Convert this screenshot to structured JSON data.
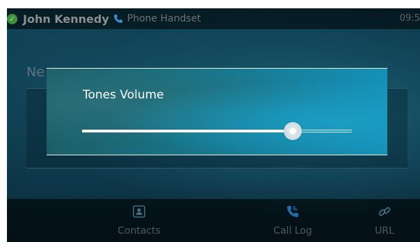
{
  "status_bar": {
    "user_name": "John Kennedy",
    "line_label": "Phone Handset",
    "clock": "09:5",
    "presence_icon": "check-circle-icon",
    "phone_icon": "phone-handset-icon"
  },
  "background_page": {
    "title": "Ne"
  },
  "dialog": {
    "title": "Tones Volume",
    "volume_fraction": 0.78
  },
  "softkeys": [
    {
      "label": "Contacts",
      "icon": "contacts-icon"
    },
    {
      "label": "Call Log",
      "icon": "call-log-icon"
    },
    {
      "label": "URL",
      "icon": "link-icon"
    }
  ],
  "colors": {
    "dialog_accent": "#1690b8",
    "presence_green": "#3f8f3f",
    "call_log_icon": "#1f6fae"
  }
}
